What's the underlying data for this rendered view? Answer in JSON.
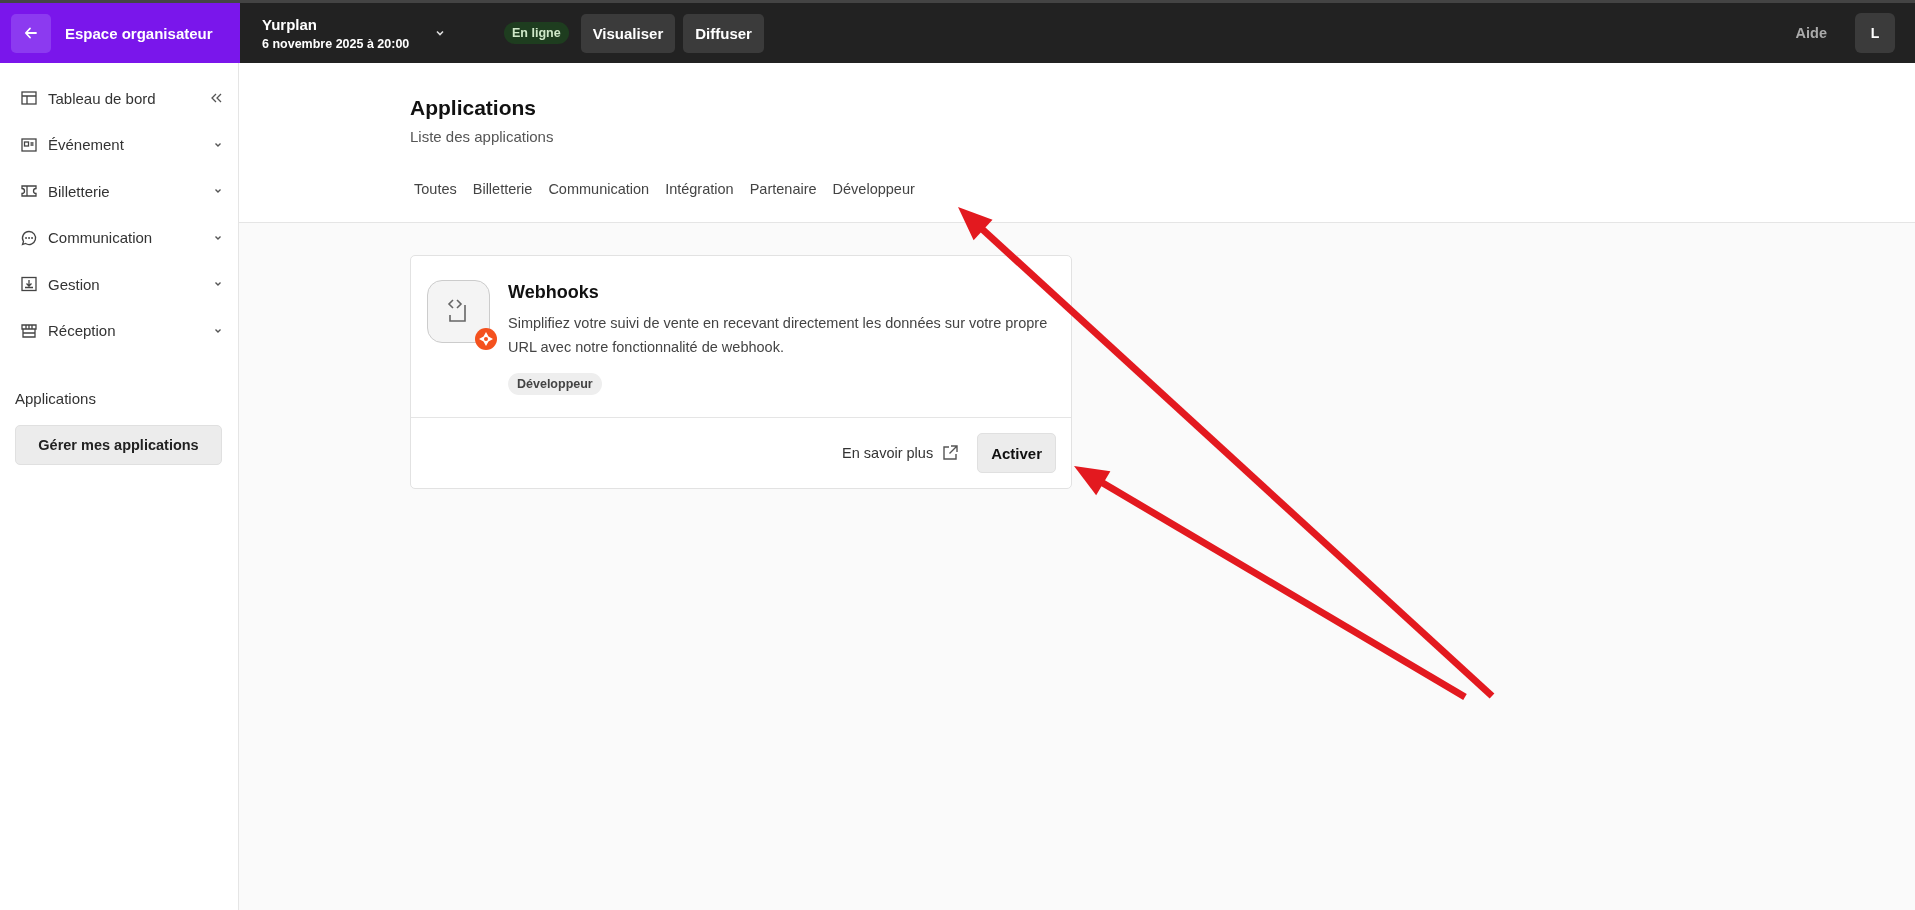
{
  "topbar": {
    "back_label": "Espace organisateur",
    "event_name": "Yurplan",
    "event_date": "6 novembre 2025 à 20:00",
    "status": "En ligne",
    "buttons": [
      "Visualiser",
      "Diffuser"
    ],
    "help": "Aide",
    "avatar": "L"
  },
  "sidebar": {
    "items": [
      {
        "label": "Tableau de bord",
        "kind": "dashboard"
      },
      {
        "label": "Événement",
        "kind": "event"
      },
      {
        "label": "Billetterie",
        "kind": "ticket"
      },
      {
        "label": "Communication",
        "kind": "chat"
      },
      {
        "label": "Gestion",
        "kind": "download"
      },
      {
        "label": "Réception",
        "kind": "store"
      }
    ],
    "section_title": "Applications",
    "manage_button": "Gérer mes applications"
  },
  "page": {
    "title": "Applications",
    "subtitle": "Liste des applications",
    "tabs": [
      "Toutes",
      "Billetterie",
      "Communication",
      "Intégration",
      "Partenaire",
      "Développeur"
    ]
  },
  "apps": [
    {
      "name": "Webhooks",
      "description": "Simplifiez votre suivi de vente en recevant directement les données sur votre propre URL avec notre fonctionnalité de webhook.",
      "tag": "Développeur",
      "link": "En savoir plus",
      "button": "Activer"
    }
  ],
  "annotations": [
    {
      "kind": "arrow"
    },
    {
      "kind": "arrow"
    }
  ]
}
